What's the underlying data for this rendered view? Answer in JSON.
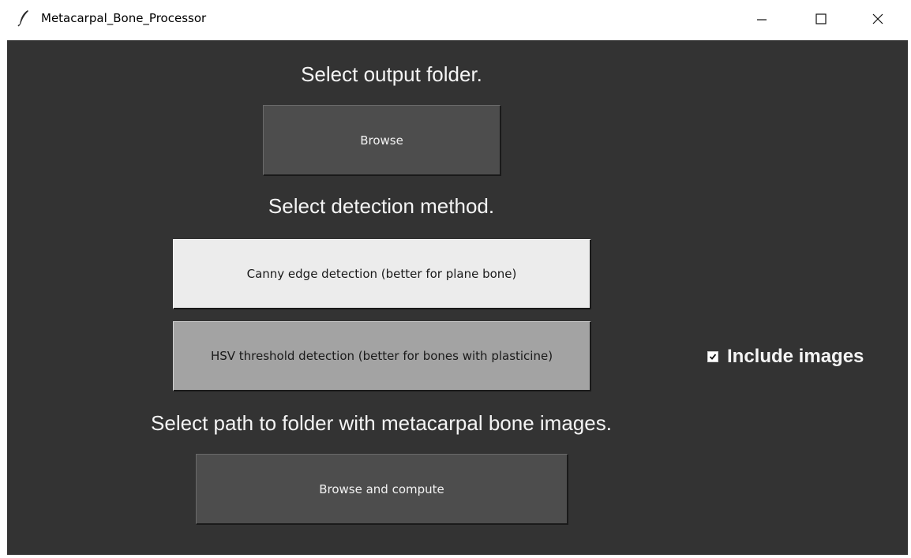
{
  "window": {
    "title": "Metacarpal_Bone_Processor",
    "icon": "feather-icon",
    "controls": {
      "minimize": "minimize-icon",
      "maximize": "maximize-icon",
      "close": "close-icon"
    }
  },
  "colors": {
    "background": "#333333",
    "label_text": "#f4f4f4",
    "dark_button": "#4d4d4d",
    "selected_method_button": "#ececec",
    "unselected_method_button": "#a3a3a3"
  },
  "output_section": {
    "label": "Select output folder.",
    "browse_button": "Browse"
  },
  "method_section": {
    "label": "Select detection method.",
    "options": [
      {
        "label": "Canny edge detection (better for plane bone)",
        "state": "selected"
      },
      {
        "label": "HSV threshold detection (better for bones with plasticine)",
        "state": "unselected"
      }
    ]
  },
  "include_images": {
    "label": "Include images",
    "checked": true
  },
  "input_section": {
    "label": "Select path to folder with metacarpal bone images.",
    "compute_button": "Browse and compute"
  }
}
